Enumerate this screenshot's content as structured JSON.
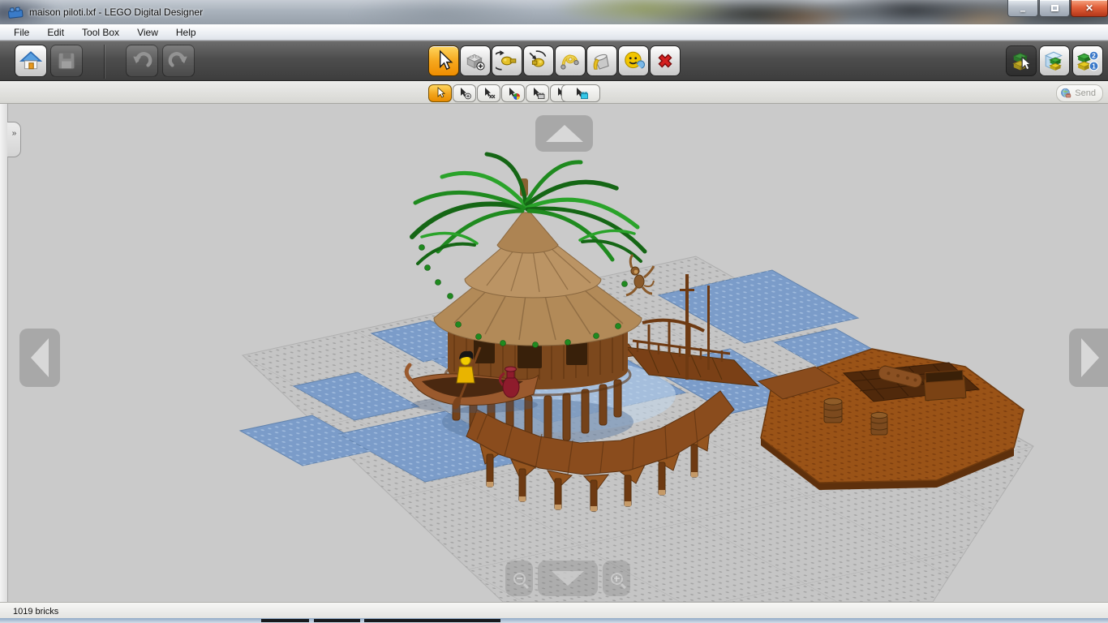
{
  "window": {
    "title": "maison piloti.lxf - LEGO Digital Designer",
    "controls": {
      "minimize": "–",
      "close": "✕"
    }
  },
  "menu": {
    "items": [
      "File",
      "Edit",
      "Tool Box",
      "View",
      "Help"
    ]
  },
  "toolbar": {
    "guide_badge_top": "2",
    "guide_badge_bottom": "1"
  },
  "sub_toolbar": {
    "send_label": "Send"
  },
  "viewport": {
    "palette_expander_glyph": "»"
  },
  "status_bar": {
    "brick_count": "1019 bricks"
  },
  "theme": {
    "accent_orange": "#f5a81b",
    "toolbar_dark": "#4a4a4a",
    "viewport_gray": "#cacaca",
    "water_blue": "#7b9cc9",
    "wood_brown": "#8a4c1d",
    "raft_brown": "#9a5317",
    "leaf_green": "#1f8a1f",
    "close_red": "#c33b1d"
  }
}
